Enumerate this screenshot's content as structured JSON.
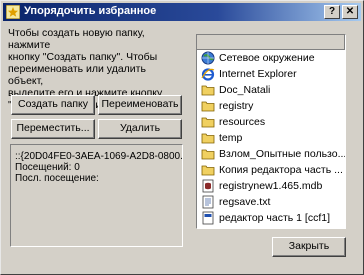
{
  "window": {
    "title": "Упорядочить избранное",
    "help_glyph": "?",
    "close_glyph": "✕"
  },
  "instructions": "Чтобы создать новую папку, нажмите\nкнопку \"Создать папку\". Чтобы\nпереименовать или удалить объект,\nвыделите его и нажмите кнопку\n\"Переименовать\" или \"Удалить\"",
  "buttons": {
    "create_folder": "Создать папку",
    "rename": "Переименовать",
    "move": "Переместить...",
    "delete": "Удалить",
    "close": "Закрыть"
  },
  "info": {
    "name": "::{20D04FE0-3AEA-1069-A2D8-0800...",
    "visits": "Посещений: 0",
    "last_visit": "Посл. посещение:"
  },
  "favorites": [
    {
      "label": "Сетевое окружение",
      "icon": "network-globe-icon"
    },
    {
      "label": "Internet Explorer",
      "icon": "internet-explorer-icon"
    },
    {
      "label": "Doc_Natali",
      "icon": "folder-icon"
    },
    {
      "label": "registry",
      "icon": "folder-icon"
    },
    {
      "label": "resources",
      "icon": "folder-icon"
    },
    {
      "label": "temp",
      "icon": "folder-icon"
    },
    {
      "label": "Взлом_Опытные пользо...",
      "icon": "folder-icon"
    },
    {
      "label": "Копия редактора часть ...",
      "icon": "folder-icon"
    },
    {
      "label": "registrynew1.465.mdb",
      "icon": "database-file-icon"
    },
    {
      "label": "regsave.txt",
      "icon": "text-file-icon"
    },
    {
      "label": "редактор часть 1 [ссf1]",
      "icon": "document-file-icon"
    }
  ],
  "colors": {
    "title_bar": "#0a246a",
    "dialog_face": "#d4d0c8",
    "folder": "#f0d060"
  }
}
